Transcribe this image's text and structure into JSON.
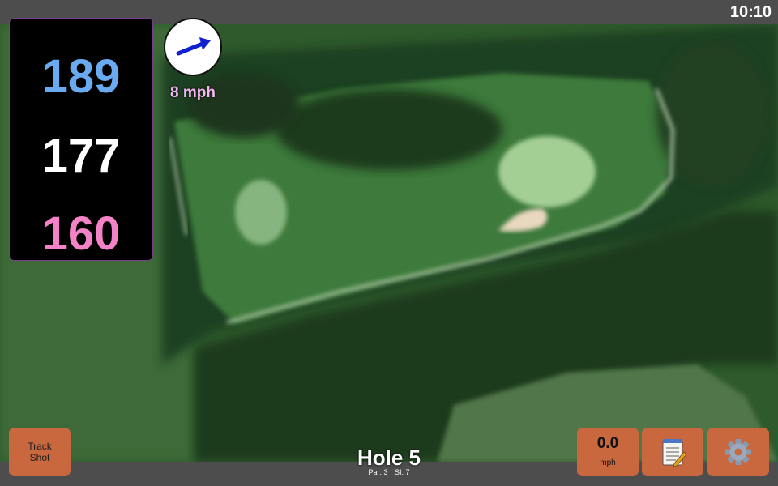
{
  "status": {
    "time": "10:10"
  },
  "yardages": {
    "back": "189",
    "middle": "177",
    "front": "160"
  },
  "wind": {
    "speed": "8 mph",
    "icon": "wind-direction-arrow-icon"
  },
  "hole": {
    "title": "Hole 5",
    "par": "Par: 3",
    "si": "SI: 7"
  },
  "buttons": {
    "track_shot_line1": "Track",
    "track_shot_line2": "Shot",
    "speed_value": "0.0",
    "speed_unit": "mph",
    "notes_icon": "notepad-icon",
    "settings_icon": "gear-icon"
  },
  "colors": {
    "back_yardage": "#6aaaf0",
    "middle_yardage": "#ffffff",
    "front_yardage": "#f382c6",
    "button_bg": "#c9683f",
    "wind_label": "#f6b8f2"
  }
}
